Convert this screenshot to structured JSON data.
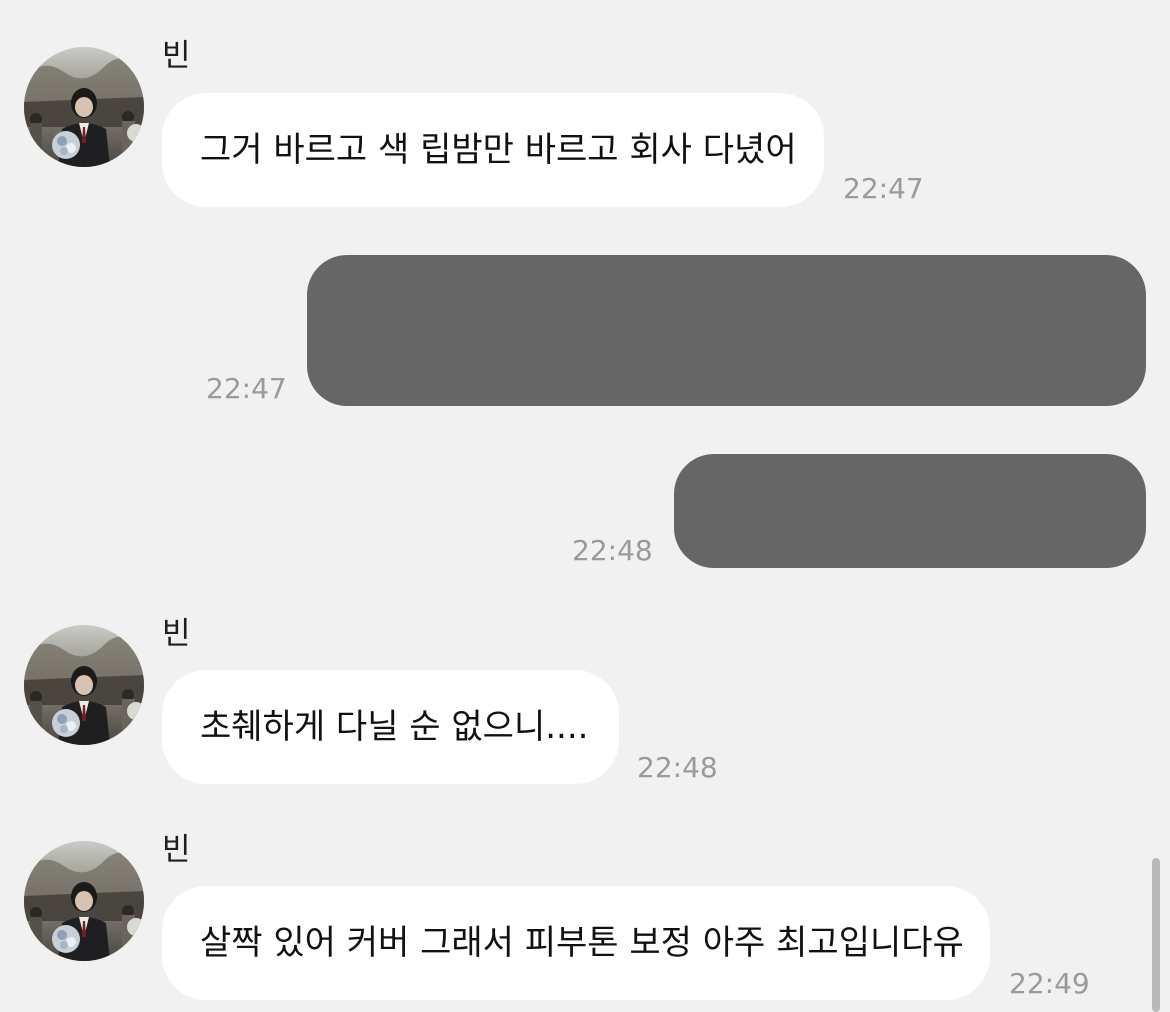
{
  "colors": {
    "background": "#f1f1f1",
    "incoming_bubble": "#ffffff",
    "outgoing_bubble_redacted": "#666666",
    "timestamp": "#9a9a9a"
  },
  "messages": [
    {
      "direction": "incoming",
      "sender": "빈",
      "avatar_icon": "profile-photo-icon",
      "text": "그거 바르고 색 립밤만 바르고 회사 다녔어",
      "time": "22:47"
    },
    {
      "direction": "outgoing",
      "redacted": true,
      "time": "22:47"
    },
    {
      "direction": "outgoing",
      "redacted": true,
      "time": "22:48"
    },
    {
      "direction": "incoming",
      "sender": "빈",
      "avatar_icon": "profile-photo-icon",
      "text": "초췌하게 다닐 순 없으니....",
      "time": "22:48"
    },
    {
      "direction": "incoming",
      "sender": "빈",
      "avatar_icon": "profile-photo-icon",
      "text": "살짝 있어 커버 그래서 피부톤 보정 아주 최고입니다유",
      "time": "22:49"
    }
  ]
}
